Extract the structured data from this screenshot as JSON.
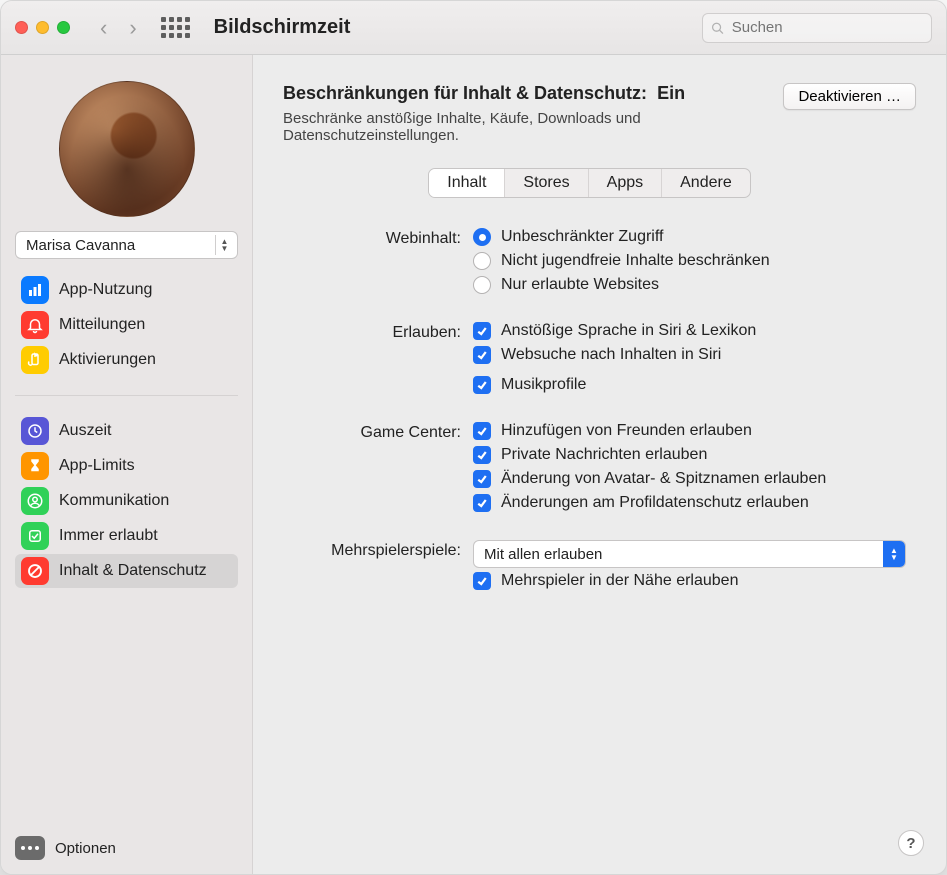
{
  "window": {
    "title": "Bildschirmzeit",
    "search_placeholder": "Suchen"
  },
  "user": {
    "name": "Marisa Cavanna"
  },
  "sidebar": {
    "group1": [
      {
        "id": "app-usage",
        "label": "App-Nutzung",
        "color": "#0a7aff",
        "icon": "bars"
      },
      {
        "id": "notifications",
        "label": "Mitteilungen",
        "color": "#ff3b30",
        "icon": "bell"
      },
      {
        "id": "pickups",
        "label": "Aktivierungen",
        "color": "#ffcc00",
        "icon": "pickup"
      }
    ],
    "group2": [
      {
        "id": "downtime",
        "label": "Auszeit",
        "color": "#5856d6",
        "icon": "clockmoon"
      },
      {
        "id": "app-limits",
        "label": "App-Limits",
        "color": "#ff9500",
        "icon": "hourglass"
      },
      {
        "id": "communication",
        "label": "Kommunikation",
        "color": "#30d158",
        "icon": "person"
      },
      {
        "id": "always-allowed",
        "label": "Immer erlaubt",
        "color": "#30d158",
        "icon": "checkshield"
      },
      {
        "id": "content-privacy",
        "label": "Inhalt & Datenschutz",
        "color": "#ff3b30",
        "icon": "nosign",
        "selected": true
      }
    ],
    "options_label": "Optionen"
  },
  "header": {
    "title_prefix": "Beschränkungen für Inhalt & Datenschutz:",
    "status": "Ein",
    "subtitle": "Beschränke anstößige Inhalte, Käufe, Downloads und Datenschutzeinstellungen.",
    "disable_button": "Deaktivieren …"
  },
  "tabs": {
    "items": [
      "Inhalt",
      "Stores",
      "Apps",
      "Andere"
    ],
    "active": 0
  },
  "form": {
    "webcontent": {
      "label": "Webinhalt:",
      "options": [
        "Unbeschränkter Zugriff",
        "Nicht jugendfreie Inhalte beschränken",
        "Nur erlaubte Websites"
      ],
      "selected": 0
    },
    "allow": {
      "label": "Erlauben:",
      "items": [
        "Anstößige Sprache in Siri & Lexikon",
        "Websuche nach Inhalten in Siri"
      ],
      "items2": [
        "Musikprofile"
      ]
    },
    "gamecenter": {
      "label": "Game Center:",
      "items": [
        "Hinzufügen von Freunden erlauben",
        "Private Nachrichten erlauben",
        "Änderung von Avatar- & Spitznamen erlauben",
        "Änderungen am Profildatenschutz erlauben"
      ]
    },
    "multiplayer": {
      "label": "Mehrspielerspiele:",
      "select_value": "Mit allen erlauben",
      "nearby": "Mehrspieler in der Nähe erlauben"
    }
  },
  "help": "?"
}
